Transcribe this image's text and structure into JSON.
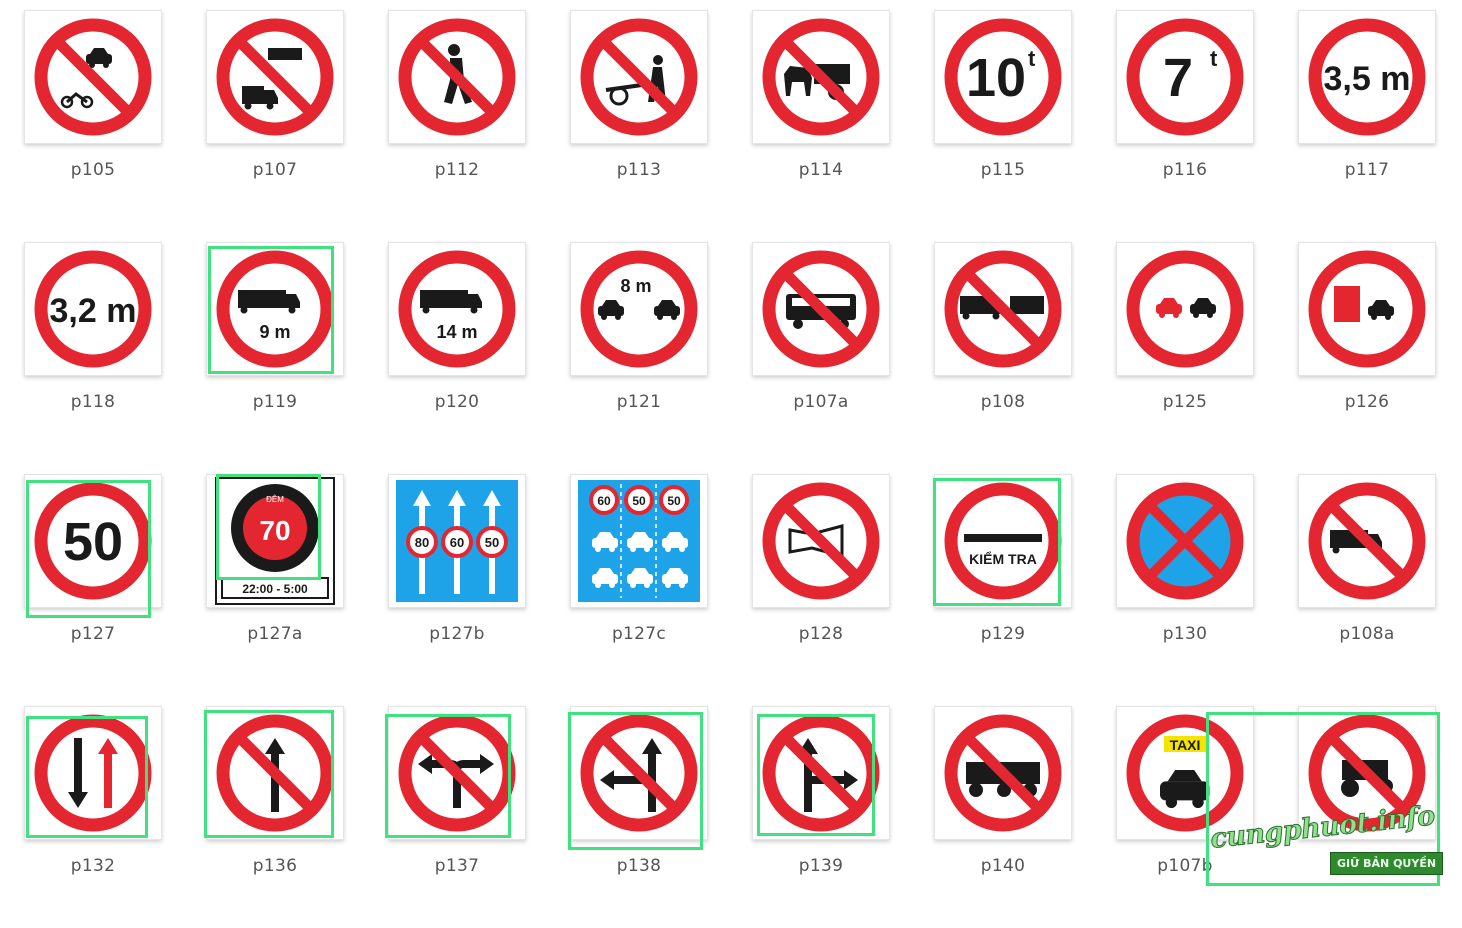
{
  "signs": [
    {
      "code": "p105",
      "kind": "car-moto"
    },
    {
      "code": "p107",
      "kind": "bus-truck"
    },
    {
      "code": "p112",
      "kind": "pedestrian"
    },
    {
      "code": "p113",
      "kind": "handcart"
    },
    {
      "code": "p114",
      "kind": "horsecart"
    },
    {
      "code": "p115",
      "kind": "text",
      "text": "10",
      "sup": "t"
    },
    {
      "code": "p116",
      "kind": "text",
      "text": "7",
      "sup": "t"
    },
    {
      "code": "p117",
      "kind": "text",
      "text": "3,5 m"
    },
    {
      "code": "p118",
      "kind": "text",
      "text": "3,2 m"
    },
    {
      "code": "p119",
      "kind": "truck-length",
      "text": "9 m"
    },
    {
      "code": "p120",
      "kind": "truck-length",
      "text": "14 m"
    },
    {
      "code": "p121",
      "kind": "distance",
      "text": "8 m"
    },
    {
      "code": "p107a",
      "kind": "bus"
    },
    {
      "code": "p108",
      "kind": "trailer"
    },
    {
      "code": "p125",
      "kind": "overtake"
    },
    {
      "code": "p126",
      "kind": "truck-overtake"
    },
    {
      "code": "p127",
      "kind": "text",
      "text": "50"
    },
    {
      "code": "p127a",
      "kind": "night-limit",
      "top": "ĐÊM",
      "text": "70",
      "time": "22:00 - 5:00"
    },
    {
      "code": "p127b",
      "kind": "lanes",
      "limits": [
        "80",
        "60",
        "50"
      ]
    },
    {
      "code": "p127c",
      "kind": "lane-vehicles",
      "limits": [
        "60",
        "50",
        "50"
      ]
    },
    {
      "code": "p128",
      "kind": "horn"
    },
    {
      "code": "p129",
      "kind": "check",
      "text": "KIỂM TRA"
    },
    {
      "code": "p130",
      "kind": "no-stop"
    },
    {
      "code": "p108a",
      "kind": "truck"
    },
    {
      "code": "p132",
      "kind": "priority"
    },
    {
      "code": "p136",
      "kind": "straight"
    },
    {
      "code": "p137",
      "kind": "turn-lr"
    },
    {
      "code": "p138",
      "kind": "straight-left"
    },
    {
      "code": "p139",
      "kind": "straight-right"
    },
    {
      "code": "p140",
      "kind": "tractor-3"
    },
    {
      "code": "p107b",
      "kind": "taxi",
      "text": "TAXI"
    },
    {
      "code": "p108b",
      "kind": "tractor",
      "label": "p108"
    }
  ],
  "watermark": {
    "text": "cungphuot.info",
    "badge": "GIỮ BẢN QUYỀN"
  },
  "colors": {
    "red": "#e3262f",
    "black": "#1a1a1a",
    "blue": "#1ea3e8",
    "highlight": "#3fe27f"
  }
}
